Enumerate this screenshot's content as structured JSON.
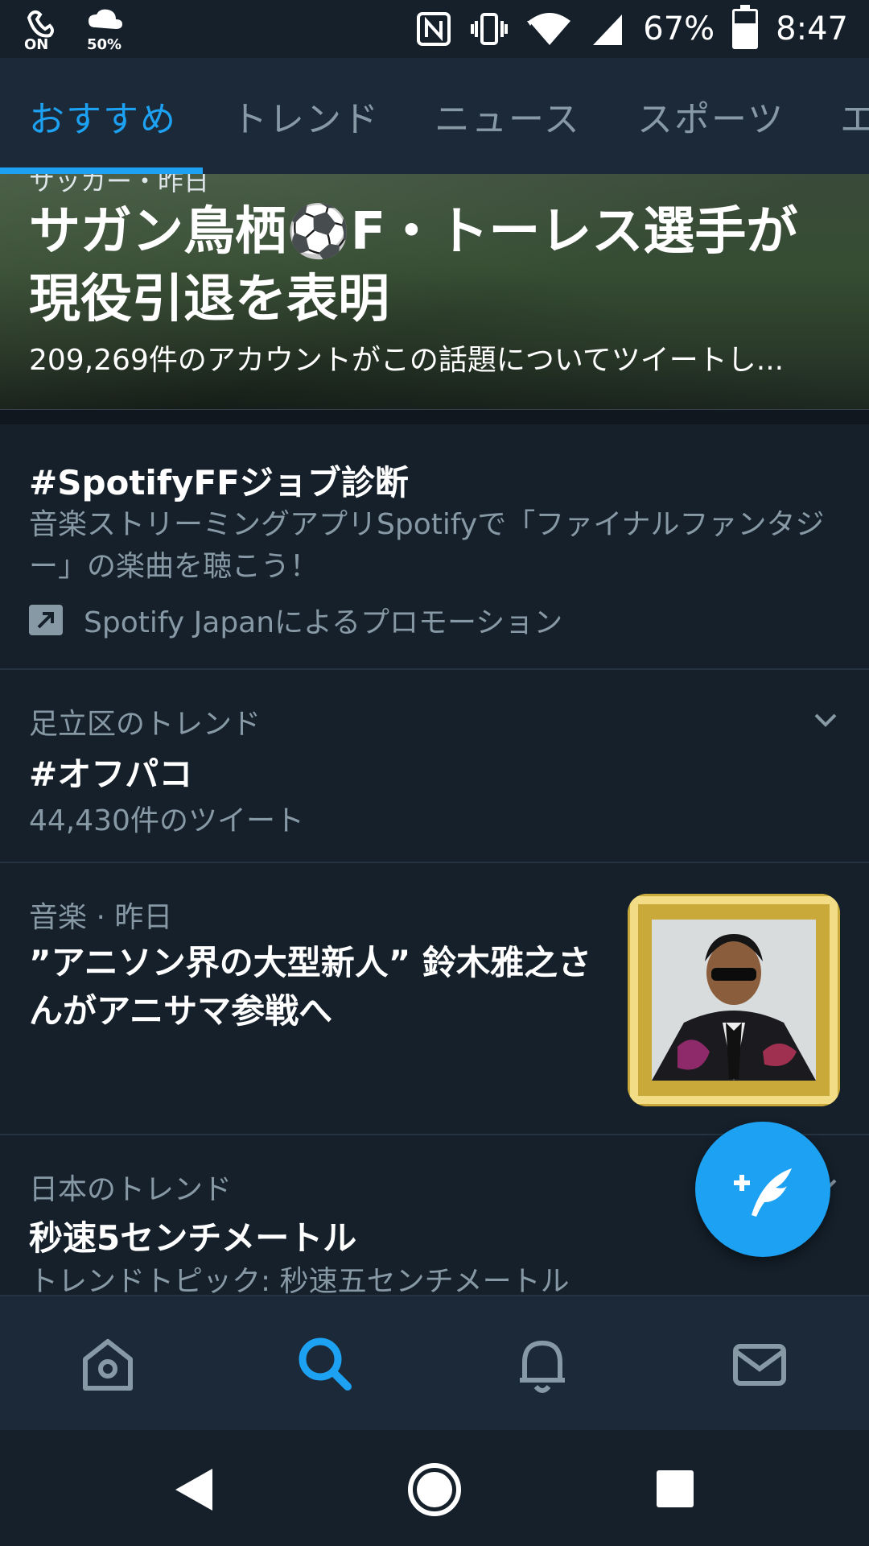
{
  "status_bar": {
    "battery_label": "67%",
    "battery_percent": 67,
    "time": "8:47",
    "weather_percent": "50%",
    "on_label": "ON"
  },
  "tabs": [
    {
      "label": "おすすめ",
      "active": true
    },
    {
      "label": "トレンド",
      "active": false
    },
    {
      "label": "ニュース",
      "active": false
    },
    {
      "label": "スポーツ",
      "active": false
    },
    {
      "label": "エ",
      "active": false
    }
  ],
  "hero": {
    "meta": "サッカー・昨日",
    "title": "サガン鳥栖⚽F・トーレス選手が現役引退を表明",
    "subtitle": "209,269件のアカウントがこの話題についてツイートし..."
  },
  "items": [
    {
      "title": "#SpotifyFFジョブ診断",
      "description": "音楽ストリーミングアプリSpotifyで「ファイナルファンタジー」の楽曲を聴こう！",
      "promo": "Spotify Japanによるプロモーション"
    },
    {
      "meta": "足立区のトレンド",
      "title": "#オフパコ",
      "count": "44,430件のツイート"
    },
    {
      "meta": "音楽 · 昨日",
      "title": "”アニソン界の大型新人” 鈴木雅之さんがアニサマ参戦へ"
    },
    {
      "meta": "日本のトレンド",
      "title": "秒速5センチメートル",
      "description": "トレンドトピック: 秒速五センチメートル"
    }
  ],
  "colors": {
    "accent": "#1da1f2",
    "background": "#15202b",
    "secondary_text": "#8899a6"
  }
}
